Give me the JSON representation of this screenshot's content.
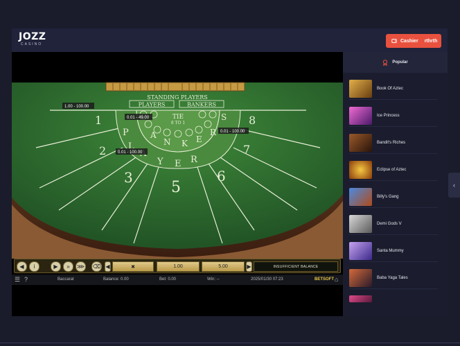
{
  "header": {
    "logo_text": "JOZZ",
    "logo_sub": "CASINO",
    "cashier_label": "Cashier",
    "username": "rthrth"
  },
  "game": {
    "table": {
      "standing_players": "STANDING PLAYERS",
      "players": "PLAYERS",
      "bankers": "BANKERS",
      "ties": "TIE",
      "ties_odds": "8 TO 1",
      "player_letters": [
        "P",
        "L",
        "A",
        "Y",
        "E",
        "R"
      ],
      "banker_letters": [
        "B",
        "A",
        "N",
        "K",
        "E",
        "R",
        "S"
      ],
      "seat_numbers": [
        "1",
        "2",
        "3",
        "5",
        "6",
        "7",
        "8"
      ],
      "limits": [
        "1.00 - 100.00",
        "0.01 - 49.00",
        "0.01 - 100.00",
        "0.01 - 100.00"
      ]
    },
    "controls": {
      "chip_value_1": "1.00",
      "chip_value_2": "5.00",
      "insufficient_balance": "INSUFFICIENT BALANCE"
    },
    "status": {
      "game_name": "Baccarat",
      "balance": "Balance: 0.00",
      "bet": "Bet: 0.00",
      "win": "Win: --",
      "datetime": "2025/01/30 07:23",
      "provider": "BETSOFT"
    }
  },
  "sidebar": {
    "section_title": "Popular",
    "games": [
      {
        "name": "Book Of Aztec",
        "color": "#b8862a"
      },
      {
        "name": "Ice Princess",
        "color": "#c2369a"
      },
      {
        "name": "Bandit's Riches",
        "color": "#6b3a1e"
      },
      {
        "name": "Eclipse of Aztec",
        "color": "#d48a1a"
      },
      {
        "name": "Billy's Gang",
        "color": "#2b5bb0"
      },
      {
        "name": "Demi Gods V",
        "color": "#8a8a8a"
      },
      {
        "name": "Santa Mummy",
        "color": "#7a4fc2"
      },
      {
        "name": "Baba Yaga Tales",
        "color": "#8a3c2a"
      }
    ]
  },
  "colors": {
    "accent": "#e9513f",
    "background": "#1a1c2c",
    "felt": "#2f6a32"
  }
}
